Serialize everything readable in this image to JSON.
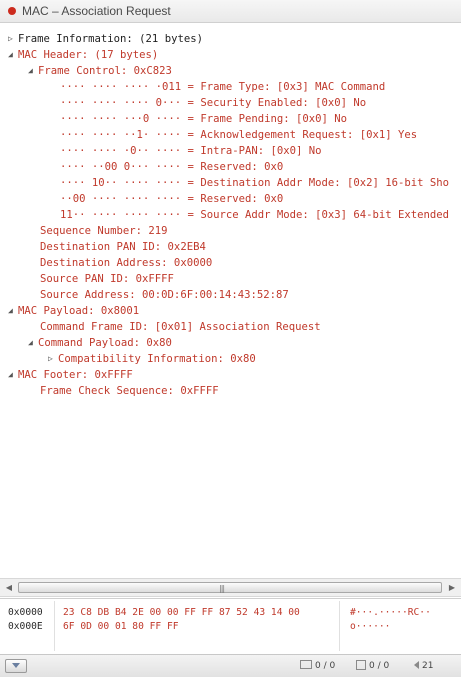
{
  "window": {
    "title": "MAC – Association Request",
    "accent": "#cc2b1e"
  },
  "tree": [
    {
      "text": "Frame Information: (21 bytes)",
      "toggle": "closed",
      "dark": true
    },
    {
      "text": "MAC Header: (17 bytes)",
      "toggle": "open"
    },
    {
      "text": "Frame Control: 0xC823",
      "toggle": "open"
    },
    {
      "text": "···· ···· ···· ·011 = Frame Type: [0x3] MAC Command",
      "toggle": ""
    },
    {
      "text": "···· ···· ···· 0··· = Security Enabled: [0x0] No",
      "toggle": ""
    },
    {
      "text": "···· ···· ···0 ···· = Frame Pending: [0x0] No",
      "toggle": ""
    },
    {
      "text": "···· ···· ··1· ···· = Acknowledgement Request: [0x1] Yes",
      "toggle": ""
    },
    {
      "text": "···· ···· ·0·· ···· = Intra-PAN: [0x0] No",
      "toggle": ""
    },
    {
      "text": "···· ··00 0··· ···· = Reserved: 0x0",
      "toggle": ""
    },
    {
      "text": "···· 10·· ···· ···· = Destination Addr Mode: [0x2] 16-bit Sho",
      "toggle": ""
    },
    {
      "text": "··00 ···· ···· ···· = Reserved: 0x0",
      "toggle": ""
    },
    {
      "text": "11·· ···· ···· ···· = Source Addr Mode: [0x3] 64-bit Extended",
      "toggle": ""
    },
    {
      "text": "Sequence Number: 219",
      "toggle": ""
    },
    {
      "text": "Destination PAN ID: 0x2EB4",
      "toggle": ""
    },
    {
      "text": "Destination Address: 0x0000",
      "toggle": ""
    },
    {
      "text": "Source PAN ID: 0xFFFF",
      "toggle": ""
    },
    {
      "text": "Source Address: 00:0D:6F:00:14:43:52:87",
      "toggle": ""
    },
    {
      "text": "MAC Payload: 0x8001",
      "toggle": "open"
    },
    {
      "text": "Command Frame ID: [0x01] Association Request",
      "toggle": ""
    },
    {
      "text": "Command Payload: 0x80",
      "toggle": "open"
    },
    {
      "text": "Compatibility Information: 0x80",
      "toggle": "closed"
    },
    {
      "text": "MAC Footer: 0xFFFF",
      "toggle": "open"
    },
    {
      "text": "Frame Check Sequence: 0xFFFF",
      "toggle": ""
    }
  ],
  "scrollbar": {
    "grip": "|||"
  },
  "hexdump": [
    {
      "offset": "0x0000",
      "hex": "23 C8 DB B4 2E 00 00 FF FF 87 52 43 14 00",
      "ascii": "#···.·····RC··"
    },
    {
      "offset": "0x000E",
      "hex": "6F 0D 00 01 80 FF FF",
      "ascii": "o······"
    }
  ],
  "statusbar": {
    "count1": "0 / 0",
    "count2": "0 / 0",
    "count3": "21"
  }
}
